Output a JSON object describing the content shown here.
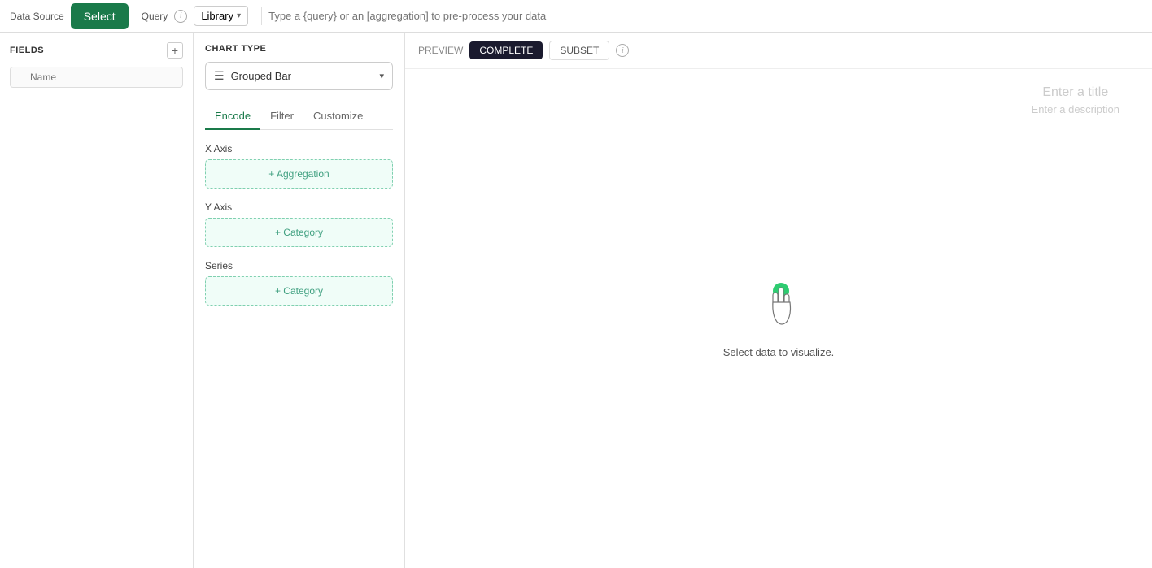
{
  "topBar": {
    "dataSourceLabel": "Data Source",
    "selectButtonLabel": "Select",
    "queryLabel": "Query",
    "queryInfoIcon": "i",
    "libraryLabel": "Library",
    "queryPlaceholder": "Type a {query} or an [aggregation] to pre-process your data"
  },
  "fieldsPanel": {
    "title": "FIELDS",
    "addIcon": "+",
    "searchPlaceholder": "Name"
  },
  "chartPanel": {
    "chartTypeLabel": "CHART TYPE",
    "selectedChart": "Grouped Bar",
    "chartIcon": "≡",
    "tabs": [
      {
        "id": "encode",
        "label": "Encode",
        "active": true
      },
      {
        "id": "filter",
        "label": "Filter",
        "active": false
      },
      {
        "id": "customize",
        "label": "Customize",
        "active": false
      }
    ],
    "xAxis": {
      "label": "X Axis",
      "dropZone": "+ Aggregation"
    },
    "yAxis": {
      "label": "Y Axis",
      "dropZone": "+ Category"
    },
    "series": {
      "label": "Series",
      "dropZone": "+ Category"
    }
  },
  "previewPanel": {
    "previewLabel": "PREVIEW",
    "completeLabel": "COMPLETE",
    "subsetLabel": "SUBSET",
    "infoIcon": "i",
    "chartTitle": "Enter a title",
    "chartDescription": "Enter a description",
    "selectDataText": "Select data to visualize."
  }
}
